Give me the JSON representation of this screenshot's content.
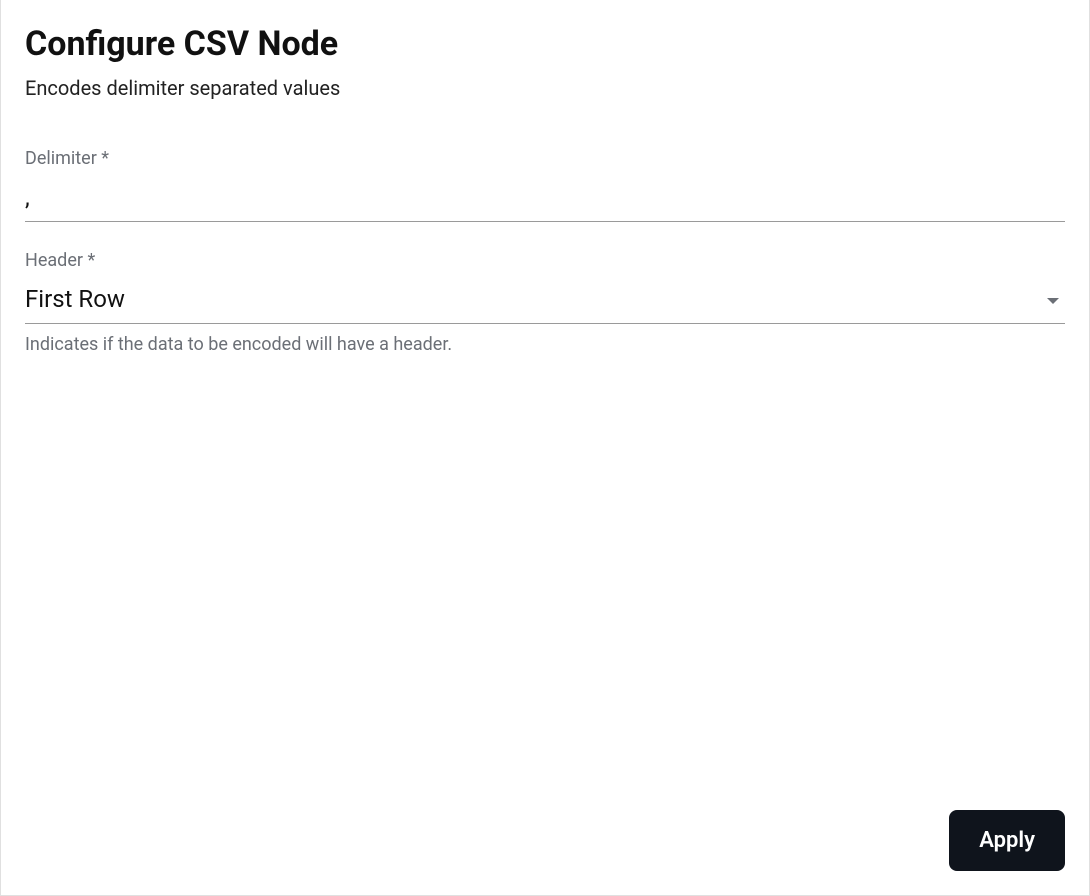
{
  "header": {
    "title": "Configure CSV Node",
    "subtitle": "Encodes delimiter separated values"
  },
  "fields": {
    "delimiter": {
      "label": "Delimiter *",
      "value": ","
    },
    "header": {
      "label": "Header *",
      "value": "First Row",
      "helper": "Indicates if the data to be encoded will have a header."
    }
  },
  "actions": {
    "apply_label": "Apply"
  }
}
